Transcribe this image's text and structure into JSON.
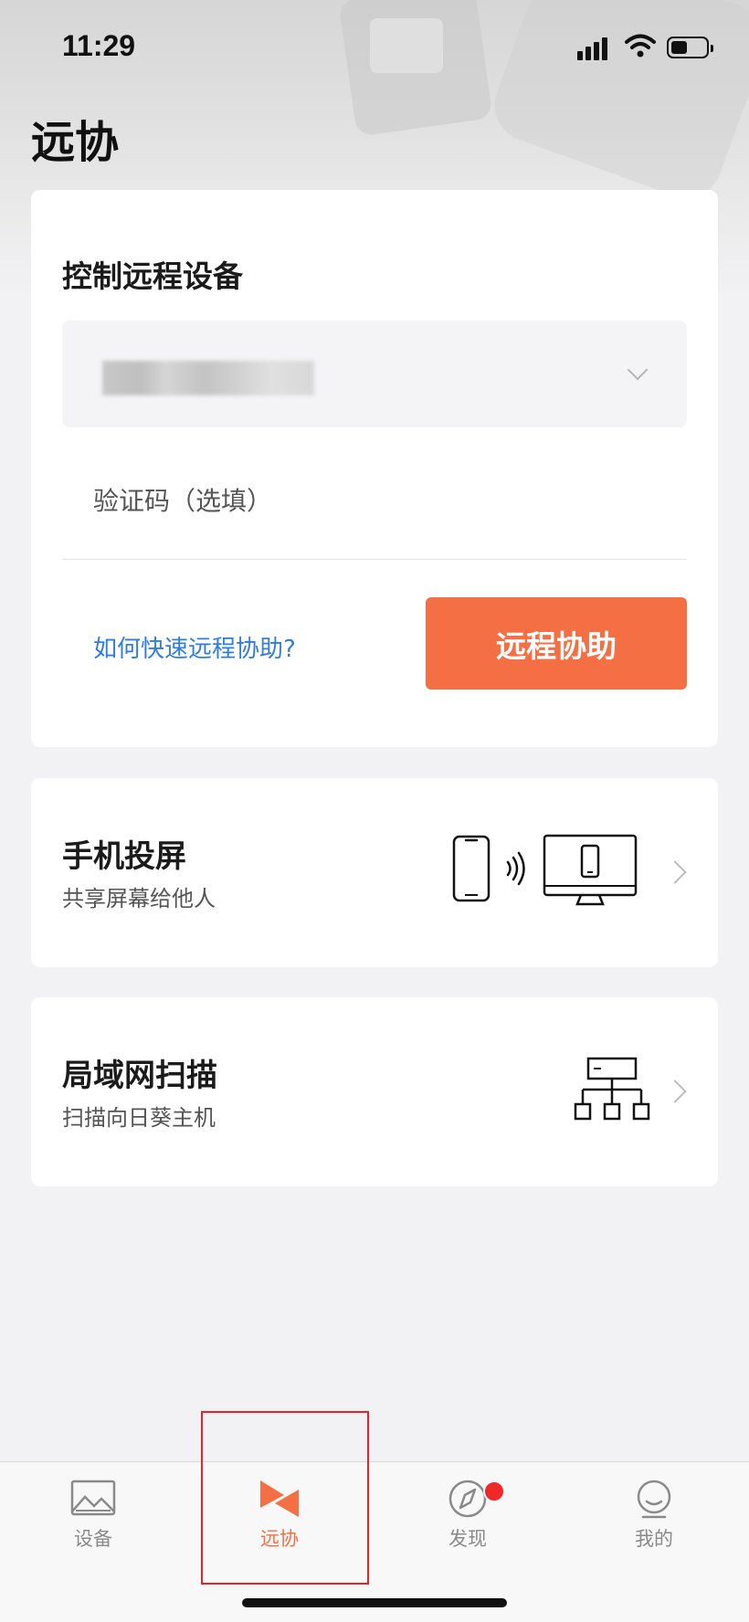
{
  "status_bar": {
    "time": "11:29"
  },
  "page": {
    "title": "远协"
  },
  "control_card": {
    "title": "控制远程设备",
    "device_select_value": "",
    "code_placeholder": "验证码（选填）",
    "help_link": "如何快速远程协助?",
    "assist_button": "远程协助"
  },
  "cast_card": {
    "title": "手机投屏",
    "subtitle": "共享屏幕给他人",
    "icon": "phone-cast-illustration"
  },
  "lan_card": {
    "title": "局域网扫描",
    "subtitle": "扫描向日葵主机",
    "icon": "network-topology-illustration"
  },
  "tab_bar": {
    "items": [
      {
        "label": "设备",
        "icon": "image-icon",
        "active": false
      },
      {
        "label": "远协",
        "icon": "remote-assist-icon",
        "active": true
      },
      {
        "label": "发现",
        "icon": "compass-icon",
        "active": false,
        "badge": true
      },
      {
        "label": "我的",
        "icon": "smiley-icon",
        "active": false
      }
    ]
  },
  "colors": {
    "accent": "#f56f44",
    "link": "#2f7de1",
    "badge": "#f0282a",
    "highlight": "#e8222a"
  }
}
